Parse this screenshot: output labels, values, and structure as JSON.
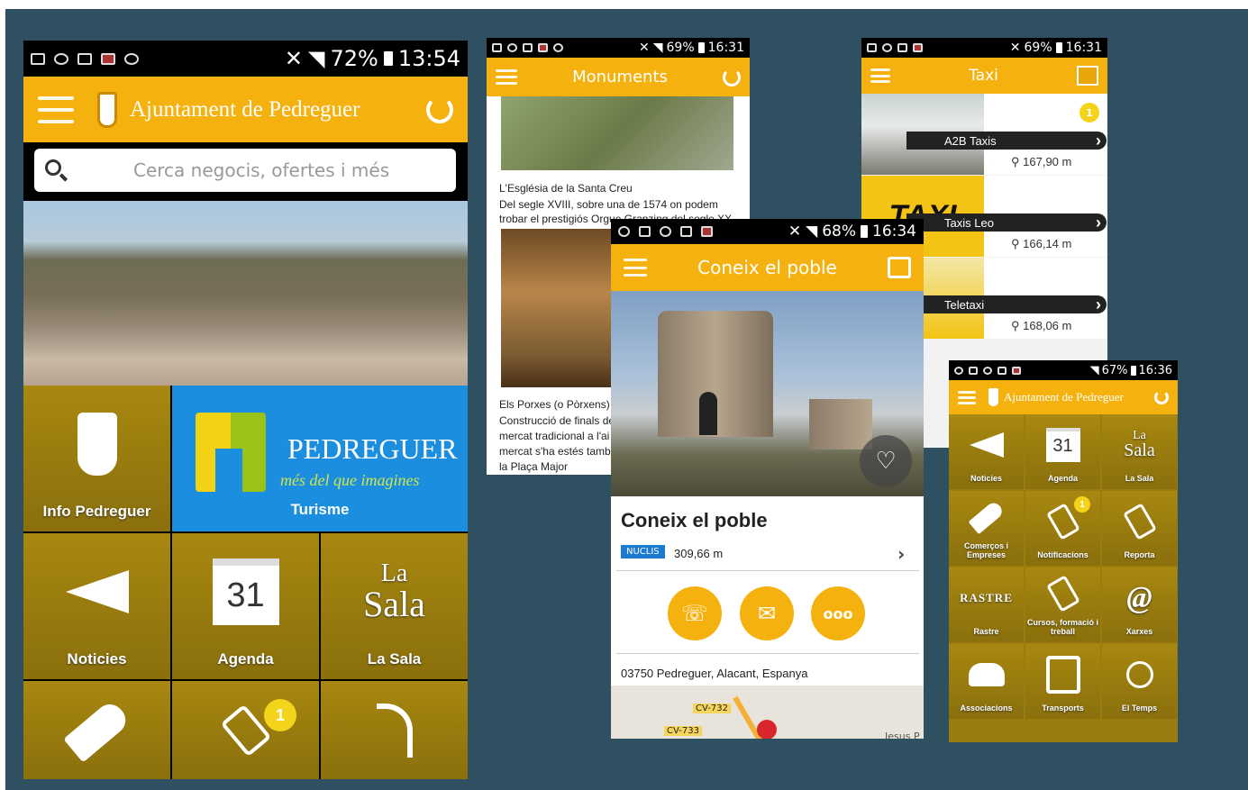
{
  "colors": {
    "background": "#2f5060",
    "accent": "#f5b20e",
    "tile": "#9a7c0f"
  },
  "phone1": {
    "status": {
      "battery": "72%",
      "time": "13:54"
    },
    "title": "Ajuntament de Pedreguer",
    "search_placeholder": "Cerca negocis, ofertes i més",
    "turisme": {
      "brand": "PEDREGUER",
      "tagline": "més del que imagines",
      "label": "Turisme"
    },
    "tiles": {
      "info": "Info Pedreguer",
      "noticies": "Noticies",
      "agenda": "Agenda",
      "agenda_day": "31",
      "lasala_logo": "La",
      "lasala_logo2": "Sala",
      "lasala": "La Sala",
      "badge": "1"
    }
  },
  "phone2": {
    "status": {
      "battery": "69%",
      "time": "16:31"
    },
    "title": "Monuments",
    "item1": {
      "name": "L'Església de la Santa Creu",
      "desc1": "Del segle XVIII, sobre una de 1574 on podem",
      "desc2": "trobar el prestigiós Orgue Granzing del segle XX"
    },
    "item2": {
      "name": "Els Porxes (o Pòrxens)",
      "l1": "Construcció de finals de",
      "l2": "mercat tradicional a l'ai",
      "l3": "mercat s'ha estés tamb",
      "l4": "la Plaça Major"
    }
  },
  "phone3": {
    "status": {
      "battery": "69%",
      "time": "16:31"
    },
    "title": "Taxi",
    "badge": "1",
    "items": [
      {
        "name": "A2B Taxis",
        "distance": "167,90 m"
      },
      {
        "name": "Taxis Leo",
        "distance": "166,14 m"
      },
      {
        "name": "Teletaxi",
        "distance": "168,06 m"
      }
    ],
    "taxi_sign": "TAXI"
  },
  "phone4": {
    "status": {
      "battery": "68%",
      "time": "16:34"
    },
    "title": "Coneix el poble",
    "heading": "Coneix el poble",
    "tag": "NUCLIS",
    "distance": "309,66 m",
    "address": "03750 Pedreguer, Alacant, Espanya",
    "map_labels": {
      "road1": "CV-732",
      "road2": "CV-733",
      "place": "Jesus P"
    },
    "more": "ooo"
  },
  "phone5": {
    "status": {
      "battery": "67%",
      "time": "16:36"
    },
    "title": "Ajuntament de Pedreguer",
    "tiles": [
      {
        "label": "Noticies",
        "icon": "megaphone-icon"
      },
      {
        "label": "Agenda",
        "icon": "calendar-icon",
        "day": "31"
      },
      {
        "label": "La Sala",
        "icon": "la-sala-icon",
        "logo1": "La",
        "logo2": "Sala"
      },
      {
        "label": "Comerços i Empreses",
        "icon": "tag-icon"
      },
      {
        "label": "Notificacions",
        "icon": "notification-icon",
        "badge": "1"
      },
      {
        "label": "Reporta",
        "icon": "report-icon"
      },
      {
        "label": "Rastre",
        "icon": "rastre-icon",
        "logo": "RASTRE"
      },
      {
        "label": "Cursos, formació i treball",
        "icon": "training-icon"
      },
      {
        "label": "Xarxes",
        "icon": "at-icon",
        "symbol": "@"
      },
      {
        "label": "Associacions",
        "icon": "people-icon"
      },
      {
        "label": "Transports",
        "icon": "bus-icon"
      },
      {
        "label": "El Temps",
        "icon": "sun-icon"
      }
    ]
  }
}
